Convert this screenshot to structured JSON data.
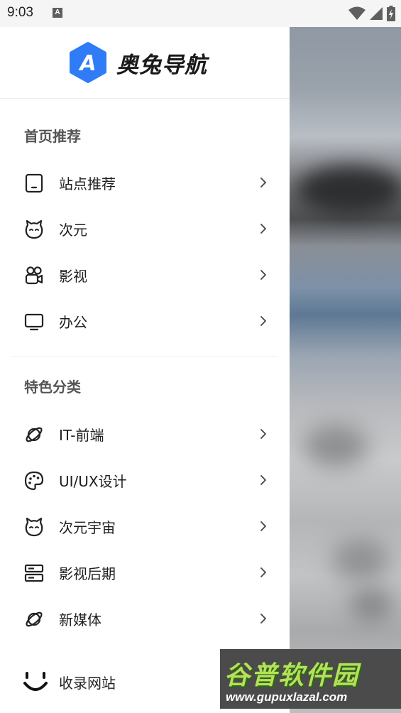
{
  "status_bar": {
    "time": "9:03",
    "notification_icon": "a-letter-icon",
    "icons": [
      "wifi-icon",
      "signal-icon",
      "battery-charging-icon"
    ]
  },
  "drawer": {
    "app_name": "奥兔导航",
    "logo_letter": "A",
    "logo_color": "#2f7cf6",
    "sections": [
      {
        "title": "首页推荐",
        "items": [
          {
            "label": "站点推荐",
            "icon": "tablet-icon"
          },
          {
            "label": "次元",
            "icon": "cat-face-icon"
          },
          {
            "label": "影视",
            "icon": "video-camera-icon"
          },
          {
            "label": "办公",
            "icon": "monitor-icon"
          }
        ]
      },
      {
        "title": "特色分类",
        "items": [
          {
            "label": "IT-前端",
            "icon": "planet-icon"
          },
          {
            "label": "UI/UX设计",
            "icon": "palette-icon"
          },
          {
            "label": "次元宇宙",
            "icon": "cat-face-icon"
          },
          {
            "label": "影视后期",
            "icon": "server-icon"
          },
          {
            "label": "新媒体",
            "icon": "planet-icon"
          }
        ]
      }
    ],
    "footer_item": {
      "label": "收录网站",
      "icon": "smiley-icon"
    }
  },
  "watermark": {
    "main": "谷普软件园",
    "sub": "www.gupuxlazal.com"
  }
}
